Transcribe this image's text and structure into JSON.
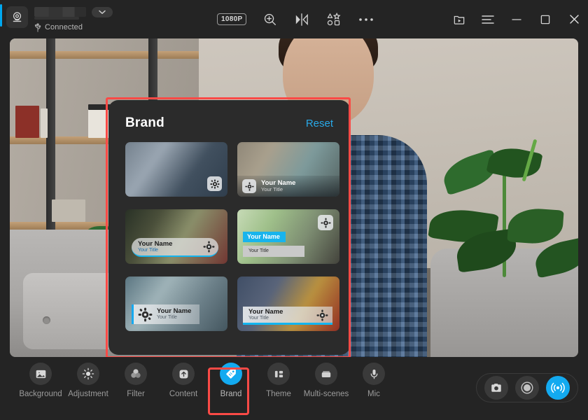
{
  "titlebar": {
    "camera_icon": "webcam-icon",
    "device_name": "",
    "device_dropdown_icon": "chevron-down-icon",
    "usb_icon": "usb-icon",
    "connection_status": "Connected",
    "tools": [
      {
        "name": "resolution-badge",
        "label": "1080P",
        "icon": ""
      },
      {
        "name": "zoom-in-button",
        "label": "",
        "icon": "zoom-in-icon"
      },
      {
        "name": "mirror-flip-button",
        "label": "",
        "icon": "mirror-flip-icon"
      },
      {
        "name": "ai-effects-button",
        "label": "",
        "icon": "shapes-icon"
      },
      {
        "name": "more-options-button",
        "label": "",
        "icon": "ellipsis-icon"
      }
    ],
    "window_tools": [
      {
        "name": "media-library-button",
        "icon": "folder-play-icon"
      },
      {
        "name": "menu-button",
        "icon": "hamburger-icon"
      },
      {
        "name": "minimize-button",
        "icon": "minimize-icon"
      },
      {
        "name": "maximize-button",
        "icon": "maximize-icon"
      },
      {
        "name": "close-button",
        "icon": "close-icon"
      }
    ]
  },
  "brand_panel": {
    "title": "Brand",
    "reset_label": "Reset",
    "templates": [
      {
        "id": "tpl-1",
        "style": "logo-only",
        "name": "",
        "title": ""
      },
      {
        "id": "tpl-2",
        "style": "dark-lower-third",
        "name": "Your Name",
        "title": "Your Title"
      },
      {
        "id": "tpl-3",
        "style": "pill-frosted",
        "name": "Your Name",
        "title": "Your Title"
      },
      {
        "id": "tpl-4",
        "style": "blocks-cyan",
        "name": "Your Name",
        "title": "Your Title"
      },
      {
        "id": "tpl-5",
        "style": "left-accent-bar",
        "name": "Your Name",
        "title": "Your Title"
      },
      {
        "id": "tpl-6",
        "style": "wide-underline",
        "name": "Your Name",
        "title": "Your Title"
      }
    ]
  },
  "bottombar": {
    "items": [
      {
        "label": "Background",
        "icon": "image-icon",
        "active": false
      },
      {
        "label": "Adjustment",
        "icon": "sun-icon",
        "active": false
      },
      {
        "label": "Filter",
        "icon": "filter-circles-icon",
        "active": false
      },
      {
        "label": "Content",
        "icon": "upload-arrow-icon",
        "active": false
      },
      {
        "label": "Brand",
        "icon": "tag-icon",
        "active": true
      },
      {
        "label": "Theme",
        "icon": "layout-icon",
        "active": false
      },
      {
        "label": "Multi-scenes",
        "icon": "scenes-icon",
        "active": false
      },
      {
        "label": "Mic",
        "icon": "microphone-icon",
        "active": false
      }
    ],
    "capture": [
      {
        "name": "snapshot-button",
        "icon": "camera-icon",
        "active": false
      },
      {
        "name": "record-button",
        "icon": "record-icon",
        "active": false
      },
      {
        "name": "broadcast-button",
        "icon": "broadcast-icon",
        "active": true
      }
    ]
  },
  "colors": {
    "accent_blue": "#13aaf0",
    "reset_link": "#29a9e8",
    "highlight_red": "#fa4a46",
    "panel_bg": "#2b2b2b",
    "app_bg": "#242424"
  }
}
